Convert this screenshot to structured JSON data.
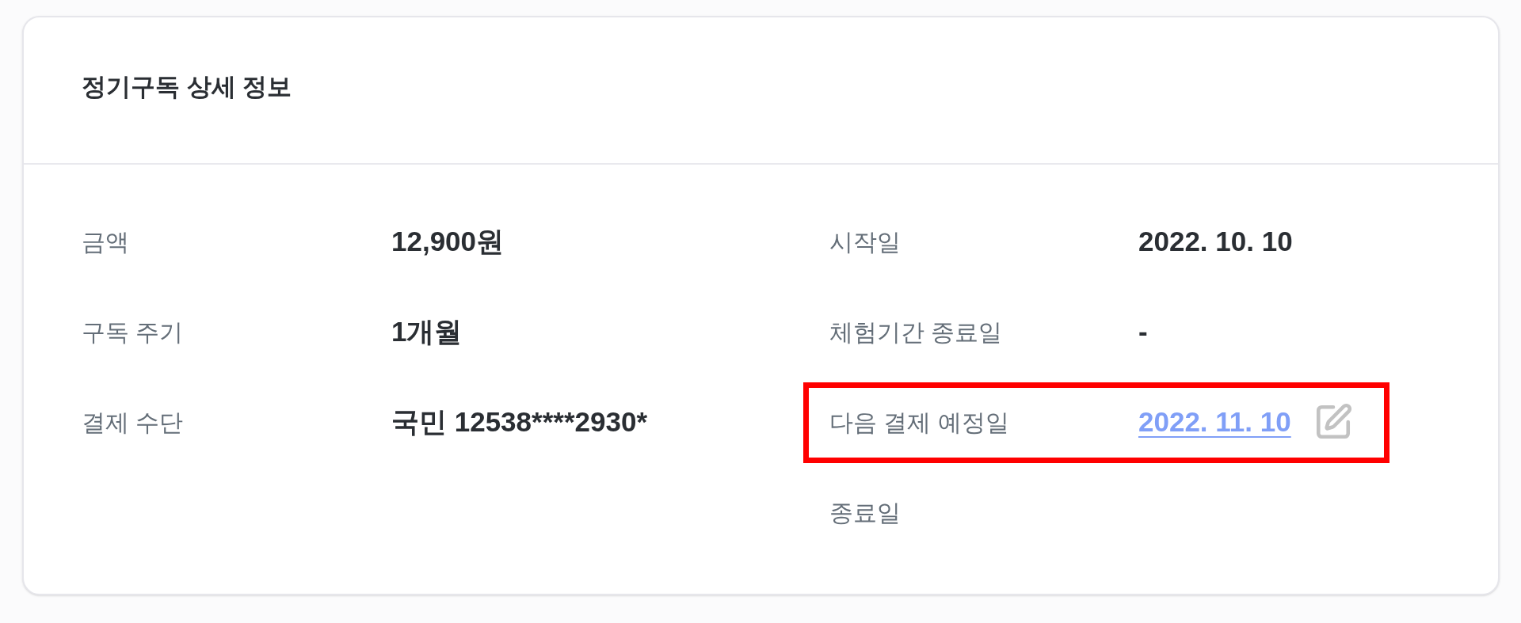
{
  "card": {
    "title": "정기구독 상세 정보"
  },
  "details": {
    "left": [
      {
        "label": "금액",
        "value": "12,900원"
      },
      {
        "label": "구독 주기",
        "value": "1개월"
      },
      {
        "label": "결제 수단",
        "value": "국민 12538****2930*"
      }
    ],
    "right": [
      {
        "kind": "text",
        "label": "시작일",
        "value": "2022. 10. 10",
        "highlighted": false
      },
      {
        "kind": "text",
        "label": "체험기간 종료일",
        "value": "-",
        "highlighted": false
      },
      {
        "kind": "editable",
        "label": "다음 결제 예정일",
        "value": "2022. 11. 10",
        "highlighted": true
      },
      {
        "kind": "text",
        "label": "종료일",
        "highlighted": false
      }
    ]
  }
}
